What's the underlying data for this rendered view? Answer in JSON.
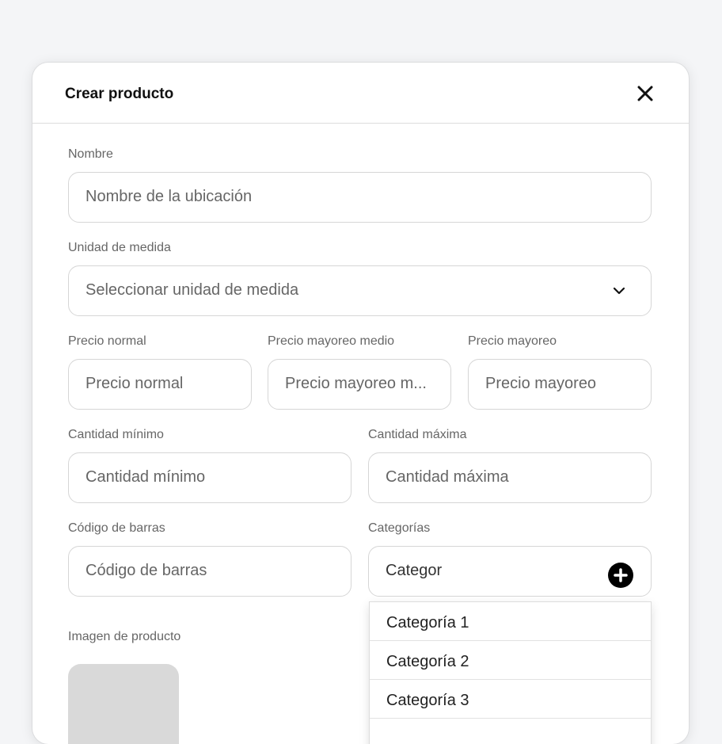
{
  "modal": {
    "title": "Crear producto"
  },
  "form": {
    "nombre": {
      "label": "Nombre",
      "placeholder": "Nombre de la ubicación"
    },
    "unidad": {
      "label": "Unidad de medida",
      "placeholder": "Seleccionar unidad de medida"
    },
    "precio_normal": {
      "label": "Precio normal",
      "placeholder": "Precio normal"
    },
    "precio_mayoreo_medio": {
      "label": "Precio mayoreo medio",
      "placeholder": "Precio mayoreo m..."
    },
    "precio_mayoreo": {
      "label": "Precio mayoreo",
      "placeholder": "Precio mayoreo"
    },
    "cantidad_minimo": {
      "label": "Cantidad mínimo",
      "placeholder": "Cantidad mínimo"
    },
    "cantidad_maxima": {
      "label": "Cantidad máxima",
      "placeholder": "Cantidad máxima"
    },
    "codigo_barras": {
      "label": "Código de barras",
      "placeholder": "Código de barras"
    },
    "categorias": {
      "label": "Categorías",
      "value": "Categor"
    },
    "imagen": {
      "label": "Imagen de producto"
    }
  },
  "dropdown": {
    "items": [
      {
        "label": "Categoría 1"
      },
      {
        "label": "Categoría 2"
      },
      {
        "label": "Categoría 3"
      }
    ]
  },
  "icons": {
    "close": "close-icon",
    "chevron": "chevron-down-icon",
    "add": "plus-circle-icon"
  },
  "colors": {
    "background": "#f4f5f7",
    "surface": "#ffffff",
    "border": "#d6d6d6",
    "placeholder_text": "#666666",
    "image_placeholder": "#d9d9d9",
    "primary_text": "#111111"
  }
}
